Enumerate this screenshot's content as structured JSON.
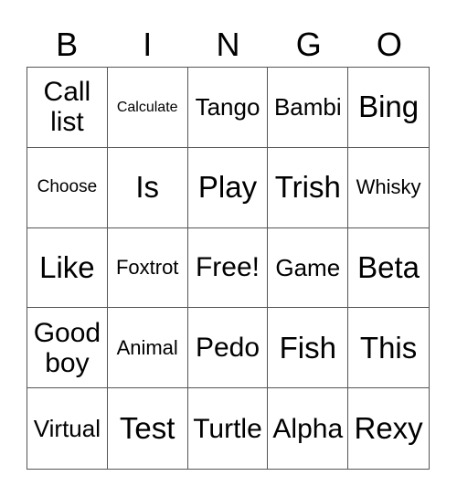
{
  "header": [
    "B",
    "I",
    "N",
    "G",
    "O"
  ],
  "cells": [
    {
      "text": "Call list",
      "size": "l"
    },
    {
      "text": "Calculate",
      "size": "xs"
    },
    {
      "text": "Tango",
      "size": "m"
    },
    {
      "text": "Bambi",
      "size": "m"
    },
    {
      "text": "Bing",
      "size": "xl"
    },
    {
      "text": "Choose",
      "size": "s"
    },
    {
      "text": "Is",
      "size": "xl"
    },
    {
      "text": "Play",
      "size": "xl"
    },
    {
      "text": "Trish",
      "size": "xl"
    },
    {
      "text": "Whisky",
      "size": "sm"
    },
    {
      "text": "Like",
      "size": "xl"
    },
    {
      "text": "Foxtrot",
      "size": "sm"
    },
    {
      "text": "Free!",
      "size": "l"
    },
    {
      "text": "Game",
      "size": "m"
    },
    {
      "text": "Beta",
      "size": "xl"
    },
    {
      "text": "Good boy",
      "size": "l"
    },
    {
      "text": "Animal",
      "size": "sm"
    },
    {
      "text": "Pedo",
      "size": "l"
    },
    {
      "text": "Fish",
      "size": "xl"
    },
    {
      "text": "This",
      "size": "xl"
    },
    {
      "text": "Virtual",
      "size": "m"
    },
    {
      "text": "Test",
      "size": "xl"
    },
    {
      "text": "Turtle",
      "size": "l"
    },
    {
      "text": "Alpha",
      "size": "l"
    },
    {
      "text": "Rexy",
      "size": "xl"
    }
  ]
}
